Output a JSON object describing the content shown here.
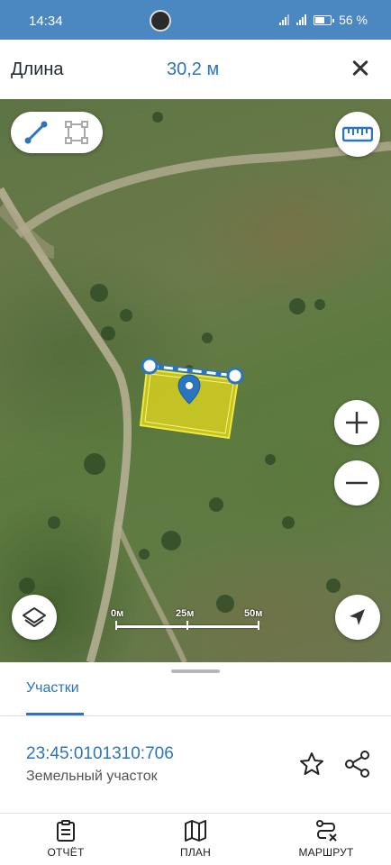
{
  "status_bar": {
    "time": "14:34",
    "battery": "56 %"
  },
  "header": {
    "title": "Длина",
    "value": "30,2 м"
  },
  "map": {
    "scale": {
      "labels": [
        "0м",
        "25м",
        "50м"
      ]
    }
  },
  "sheet": {
    "tab_label": "Участки",
    "cadastral_number": "23:45:0101310:706",
    "kind": "Земельный участок"
  },
  "nav": [
    {
      "label": "ОТЧЁТ",
      "icon": "report-icon"
    },
    {
      "label": "ПЛАН",
      "icon": "map-plan-icon"
    },
    {
      "label": "МАРШРУТ",
      "icon": "route-icon"
    }
  ],
  "colors": {
    "accent": "#2b74c0",
    "status_bar": "#4b87c0",
    "parcel_fill": "#e6dc1e"
  }
}
